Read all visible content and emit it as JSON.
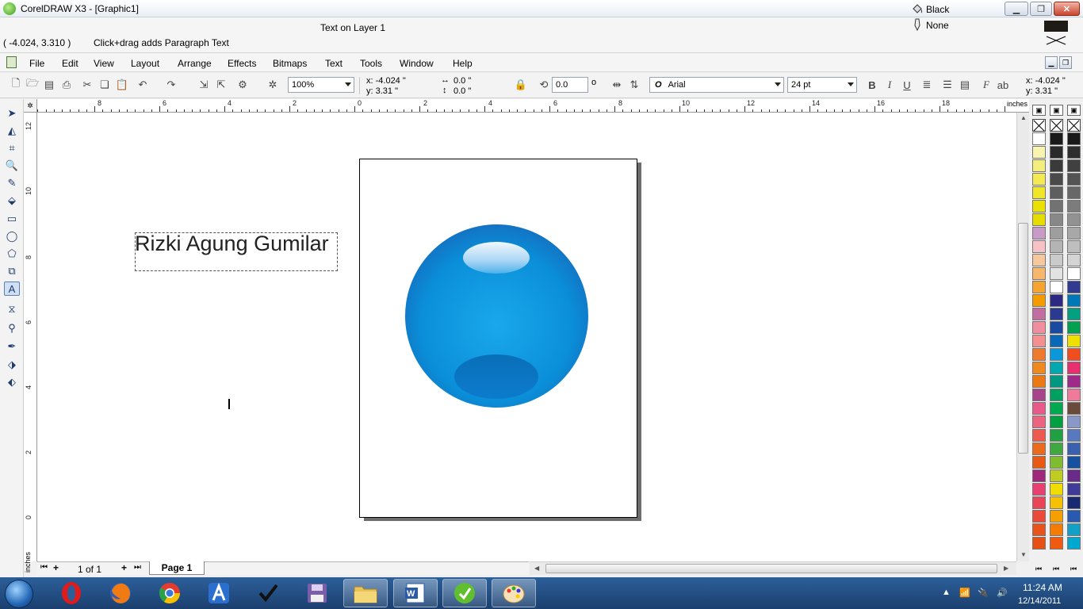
{
  "window": {
    "title": "CorelDRAW X3 - [Graphic1]",
    "min": "▁",
    "max": "❐",
    "close": "✕"
  },
  "status": {
    "layer": "Text on Layer 1",
    "coords": "( -4.024, 3.310  )",
    "hint": "Click+drag adds Paragraph Text",
    "fill": "Black",
    "outline": "None",
    "fill_color": "#1e1a16"
  },
  "menu": [
    "File",
    "Edit",
    "View",
    "Layout",
    "Arrange",
    "Effects",
    "Bitmaps",
    "Text",
    "Tools",
    "Window",
    "Help"
  ],
  "propbar": {
    "zoom": "100%",
    "x": "x: -4.024 \"",
    "y": "y: 3.31 \"",
    "w": "0.0 \"",
    "h": "0.0 \"",
    "angle": "0.0",
    "deg": "o",
    "font": "Arial",
    "font_icon": "O",
    "size": "24 pt",
    "x2": "x: -4.024 \"",
    "y2": "y: 3.31 \""
  },
  "ruler": {
    "h_labels": [
      "8",
      "6",
      "4",
      "2",
      "0",
      "2",
      "4",
      "6",
      "8",
      "10",
      "12",
      "14",
      "16",
      "18"
    ],
    "v_labels": [
      "12",
      "10",
      "8",
      "6",
      "4",
      "2",
      "0"
    ],
    "units": "inches"
  },
  "canvas": {
    "artistic_text": "Rizki Agung Gumilar"
  },
  "pagenav": {
    "count": "1 of 1",
    "tab": "Page 1"
  },
  "palettes": {
    "col1": [
      "#ffffff",
      "#f8f4b0",
      "#f4ee7e",
      "#f2ea50",
      "#efe62a",
      "#ebe100",
      "#e7dc00",
      "#c89ac8",
      "#f6c2c6",
      "#f6c79c",
      "#f6b66c",
      "#f6a330",
      "#f49b00",
      "#c36ea0",
      "#f08ea0",
      "#f49090",
      "#f07a2c",
      "#f08a1e",
      "#ec7a14",
      "#a8448a",
      "#e85a8a",
      "#ec6480",
      "#ec5a50",
      "#ec6a1c",
      "#e85a14",
      "#a0287a",
      "#e84070",
      "#ea4458",
      "#ea4a3a",
      "#e8541c",
      "#e65014"
    ],
    "col2": [
      "#1a1a1a",
      "#2a2a2a",
      "#3a3a3a",
      "#4a4a4a",
      "#5e5e5e",
      "#727272",
      "#888888",
      "#9e9e9e",
      "#b4b4b4",
      "#cacaca",
      "#e2e2e2",
      "#ffffff",
      "#2c2a80",
      "#2a3a90",
      "#1a4aa0",
      "#0a68b8",
      "#0a98d8",
      "#00a8b0",
      "#009880",
      "#00a060",
      "#00a850",
      "#00a040",
      "#20a040",
      "#40a840",
      "#80bc30",
      "#c0cc20",
      "#f0dc00",
      "#f4c000",
      "#f4a000",
      "#f47c00",
      "#f05a10"
    ],
    "col3": [
      "#1a1a1a",
      "#2e2e2e",
      "#404040",
      "#545454",
      "#686868",
      "#7c7c7c",
      "#929292",
      "#a8a8a8",
      "#bebebe",
      "#d4d4d4",
      "#ffffff",
      "#303a90",
      "#0078b8",
      "#00a080",
      "#00a050",
      "#f0e000",
      "#f04e1e",
      "#e83070",
      "#a02a8a",
      "#f07a9a",
      "#6a4a3a",
      "#8898c8",
      "#5878c0",
      "#3a60b0",
      "#1850a0",
      "#6a2a8a",
      "#403a98",
      "#1a2a70",
      "#2a5ab0",
      "#10a0c8",
      "#00a8d0"
    ]
  },
  "taskbar": {
    "time": "11:24 AM",
    "date": "12/14/2011"
  }
}
